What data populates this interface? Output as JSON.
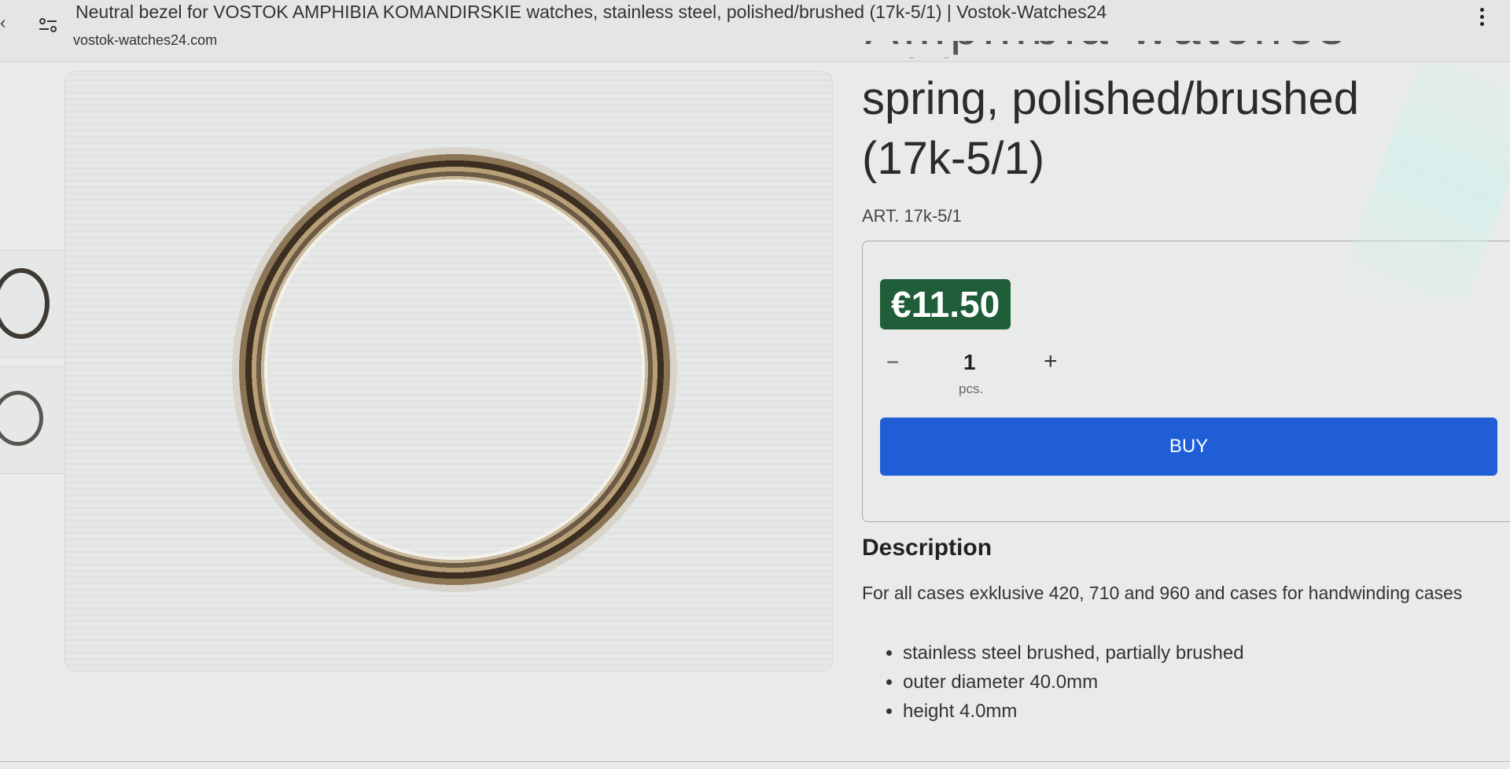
{
  "browser": {
    "page_title": "Neutral bezel for VOSTOK AMPHIBIA KOMANDIRSKIE watches, stainless steel, polished/brushed (17k-5/1) | Vostok-Watches24",
    "domain": "vostok-watches24.com"
  },
  "product": {
    "title_line1": "spring, polished/brushed",
    "title_line2": "(17k-5/1)",
    "article": "ART. 17k-5/1",
    "price": "€11.50",
    "quantity": "1",
    "unit": "pcs.",
    "minus_label": "−",
    "plus_label": "+",
    "buy_label": "BUY"
  },
  "description": {
    "heading": "Description",
    "text": "For all cases exklusive 420, 710 and 960 and cases for handwinding cases",
    "items": [
      "stainless steel brushed, partially brushed",
      "outer diameter 40.0mm",
      "height 4.0mm"
    ]
  },
  "colors": {
    "price_badge": "#1f5e39",
    "buy_button": "#1f5ed6"
  },
  "icons": [
    "back-icon",
    "tune-icon",
    "more-vert-icon"
  ]
}
